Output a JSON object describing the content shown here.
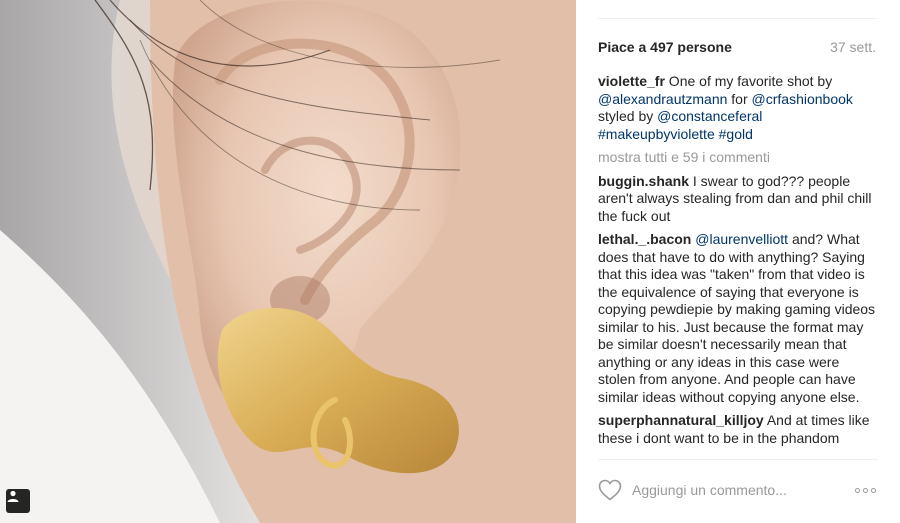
{
  "post": {
    "likes_text": "Piace a 497 persone",
    "time_ago": "37 sett.",
    "caption": {
      "user": "violette_fr",
      "segments": [
        {
          "text": " One of my favorite shot by ",
          "type": "text"
        },
        {
          "text": "@alexandrautzmann",
          "type": "mention"
        },
        {
          "text": " for ",
          "type": "text"
        },
        {
          "text": "@crfashionbook",
          "type": "mention"
        },
        {
          "text": " styled by ",
          "type": "text"
        },
        {
          "text": "@constanceferal",
          "type": "mention"
        },
        {
          "text": " ",
          "type": "text"
        },
        {
          "text": "#makeupbyviolette",
          "type": "mention"
        },
        {
          "text": " ",
          "type": "text"
        },
        {
          "text": "#gold",
          "type": "mention"
        }
      ]
    },
    "show_all_comments": "mostra tutti e 59 i commenti",
    "comments": [
      {
        "user": "buggin.shank",
        "segments": [
          {
            "text": " I swear to god??? people aren't always stealing from dan and phil chill the fuck out",
            "type": "text"
          }
        ]
      },
      {
        "user": "lethal._.bacon",
        "segments": [
          {
            "text": " ",
            "type": "text"
          },
          {
            "text": "@laurenvelliott",
            "type": "mention"
          },
          {
            "text": " and? What does that have to do with anything? Saying that this idea was \"taken\" from that video is the equivalence of saying that everyone is copying pewdiepie by making gaming videos similar to his. Just because the format may be similar doesn't necessarily mean that anything or any ideas in this case were stolen from anyone. And people can have similar ideas without copying anyone else.",
            "type": "text"
          }
        ]
      },
      {
        "user": "superphannatural_killjoy",
        "segments": [
          {
            "text": " And at times like these i dont want to be in the phandom",
            "type": "text"
          }
        ]
      }
    ],
    "comment_placeholder": "Aggiungi un commento...",
    "icons": {
      "like": "heart-outline-icon",
      "options": "more-options-icon",
      "tag": "user-tag-icon"
    },
    "colors": {
      "mention": "#003569",
      "secondary_text": "#999999",
      "gold_earring": "#d6a94e"
    }
  }
}
